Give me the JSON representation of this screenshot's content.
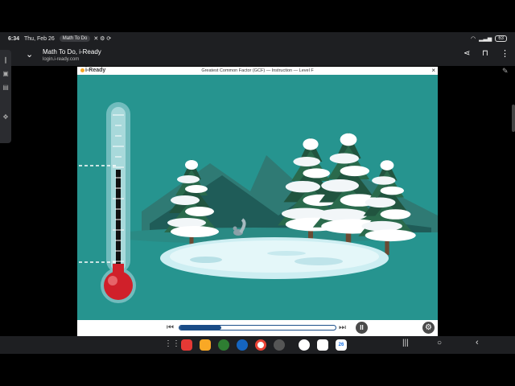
{
  "status_bar": {
    "time": "6:34",
    "date": "Thu, Feb 26",
    "notification": "Math To Do",
    "battery": "63"
  },
  "browser": {
    "title": "Math To Do, i-Ready",
    "url": "login.i-ready.com"
  },
  "app": {
    "logo": "i-Ready",
    "lesson_title": "Greatest Common Factor (GCF) — Instruction — Level F",
    "close_label": "×"
  },
  "controls": {
    "progress": 0.27,
    "pause_label": "II",
    "settings_label": "⚙"
  },
  "taskbar": {
    "calendar_day": "26"
  },
  "colors": {
    "scene_bg": "#26948f",
    "thermo_red": "#d0202a",
    "progress_fill": "#1a4c86"
  },
  "icons": [
    "back-icon",
    "chevron-down-icon",
    "share-icon",
    "bookmark-icon",
    "more-icon",
    "pen-icon",
    "close-icon",
    "previous-icon",
    "next-icon",
    "pause-icon",
    "settings-icon"
  ]
}
